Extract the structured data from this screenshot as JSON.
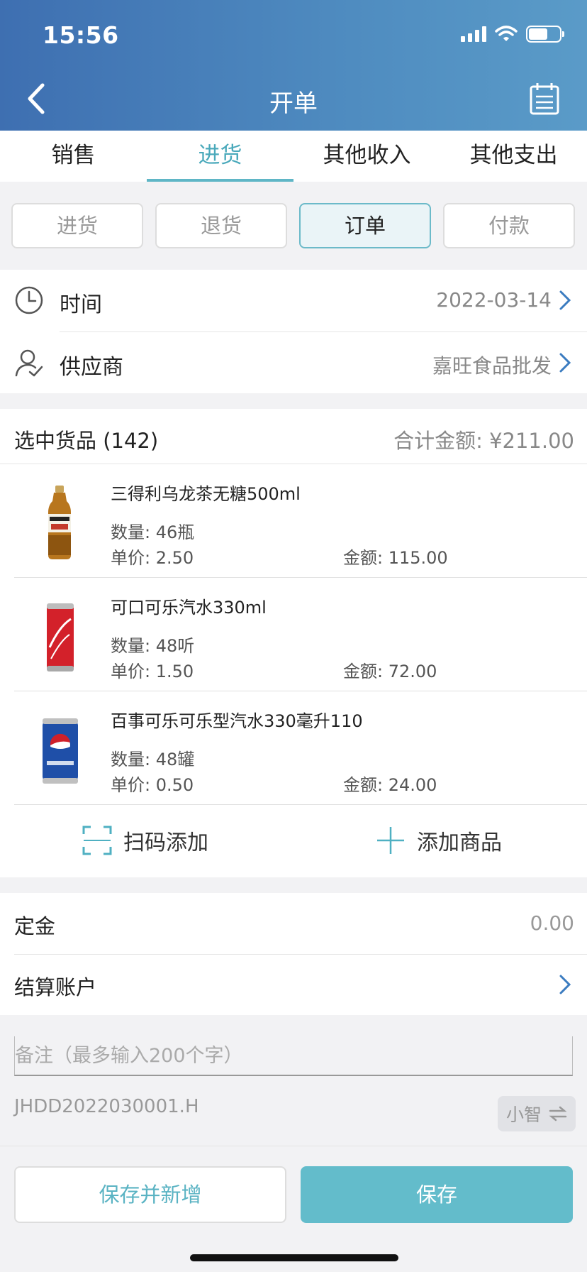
{
  "status_bar": {
    "time": "15:56"
  },
  "nav": {
    "title": "开单"
  },
  "tabs": [
    {
      "label": "销售",
      "active": false
    },
    {
      "label": "进货",
      "active": true
    },
    {
      "label": "其他收入",
      "active": false
    },
    {
      "label": "其他支出",
      "active": false
    }
  ],
  "subtabs": [
    {
      "label": "进货",
      "active": false
    },
    {
      "label": "退货",
      "active": false
    },
    {
      "label": "订单",
      "active": true
    },
    {
      "label": "付款",
      "active": false
    }
  ],
  "info": {
    "time_label": "时间",
    "time_value": "2022-03-14",
    "supplier_label": "供应商",
    "supplier_value": "嘉旺食品批发"
  },
  "goods": {
    "selected_label": "选中货品 (142)",
    "total_label": "合计金额: ¥211.00",
    "items": [
      {
        "name": "三得利乌龙茶无糖500ml",
        "qty": "数量: 46瓶",
        "price": "单价: 2.50",
        "amount": "金额: 115.00",
        "icon": "oolong-tea-bottle-icon"
      },
      {
        "name": "可口可乐汽水330ml",
        "qty": "数量: 48听",
        "price": "单价: 1.50",
        "amount": "金额: 72.00",
        "icon": "coca-cola-can-icon"
      },
      {
        "name": "百事可乐可乐型汽水330毫升110",
        "qty": "数量: 48罐",
        "price": "单价: 0.50",
        "amount": "金额: 24.00",
        "icon": "pepsi-can-icon"
      }
    ],
    "scan_add_label": "扫码添加",
    "add_goods_label": "添加商品"
  },
  "deposit": {
    "label": "定金",
    "value": "0.00"
  },
  "account": {
    "label": "结算账户"
  },
  "remark": {
    "placeholder": "备注（最多输入200个字）"
  },
  "order_no": "JHDD2022030001.H",
  "ai_button": {
    "label": "小智"
  },
  "buttons": {
    "save_new": "保存并新增",
    "save": "保存"
  },
  "colors": {
    "accent": "#5fb6c6",
    "header": "#4a82bb"
  }
}
